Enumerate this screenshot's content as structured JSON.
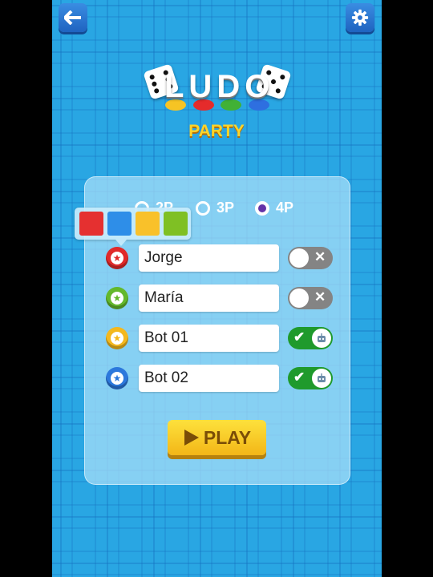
{
  "header": {
    "back_icon": "arrow-left-icon",
    "settings_icon": "gear-icon"
  },
  "logo": {
    "title": "LUDO",
    "subtitle": "PARTY",
    "token_colors": [
      "#f6c424",
      "#e52b2b",
      "#41b135",
      "#2e6fe0"
    ]
  },
  "player_count": {
    "options": [
      {
        "label": "2P",
        "selected": false
      },
      {
        "label": "3P",
        "selected": false
      },
      {
        "label": "4P",
        "selected": true
      }
    ]
  },
  "color_picker": {
    "colors": [
      "#e53030",
      "#2e8ee8",
      "#f9c12a",
      "#7fc024"
    ]
  },
  "players": [
    {
      "name": "Jorge",
      "color": "#e02a2a",
      "bot": false
    },
    {
      "name": "María",
      "color": "#63b82c",
      "bot": false
    },
    {
      "name": "Bot 01",
      "color": "#f3b81e",
      "bot": true
    },
    {
      "name": "Bot 02",
      "color": "#2c78dc",
      "bot": true
    }
  ],
  "toggle": {
    "off_icon": "x-icon",
    "on_icon": "check-icon",
    "bot_icon": "robot-icon"
  },
  "play_button": {
    "label": "PLAY",
    "icon": "play-triangle-icon"
  }
}
